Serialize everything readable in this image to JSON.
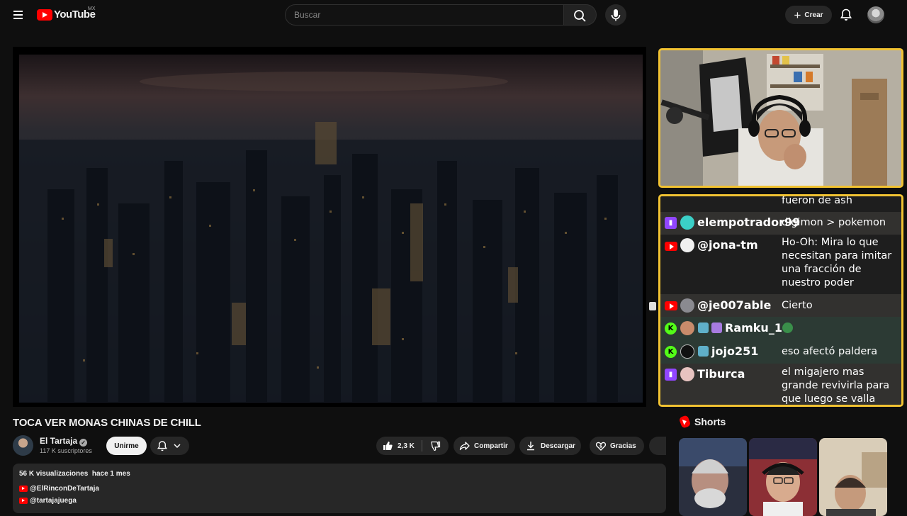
{
  "header": {
    "logo_text": "YouTube",
    "country_code": "MX",
    "search_placeholder": "Buscar",
    "create_label": "Crear",
    "icons": [
      "menu-icon",
      "search-icon",
      "mic-icon",
      "plus-icon",
      "bell-icon"
    ]
  },
  "stream_overlay": {
    "frame_color": "#f1c232",
    "chat": [
      {
        "platform": "twitch",
        "user": "",
        "text": "fueron de ash"
      },
      {
        "platform": "twitch",
        "user": "elempotrador99",
        "text": "digimon > pokemon"
      },
      {
        "platform": "youtube",
        "user": "@jona-tm",
        "text": "Ho-Oh: Mira lo que necesitan para imitar una fracción de nuestro poder"
      },
      {
        "platform": "youtube",
        "user": "@je007able",
        "text": "Cierto"
      },
      {
        "platform": "kick",
        "platform_badge": "K",
        "user": "Ramku_1",
        "text": ""
      },
      {
        "platform": "kick",
        "platform_badge": "K",
        "user": "jojo251",
        "text": "eso afectó paldera"
      },
      {
        "platform": "twitch",
        "user": "Tiburca",
        "text": "el migajero mas grande revivirla para que luego se valla"
      }
    ]
  },
  "video": {
    "title": "TOCA VER MONAS CHINAS DE CHILL",
    "channel": {
      "name": "El Tartaja",
      "verified_glyph": "✓",
      "subscribers": "117 K suscriptores",
      "join_label": "Unirme"
    },
    "actions": {
      "likes": "2,3 K",
      "share_label": "Compartir",
      "download_label": "Descargar",
      "thanks_label": "Gracias"
    },
    "description": {
      "views": "56 K visualizaciones",
      "published": "hace 1 mes",
      "links": [
        "@ElRinconDeTartaja",
        "@tartajajuega"
      ]
    }
  },
  "sidebar": {
    "shorts_title": "Shorts"
  },
  "colors": {
    "background": "#0f0f0f",
    "brand_red": "#ff0000",
    "twitch": "#9146ff",
    "kick": "#53fc18"
  }
}
